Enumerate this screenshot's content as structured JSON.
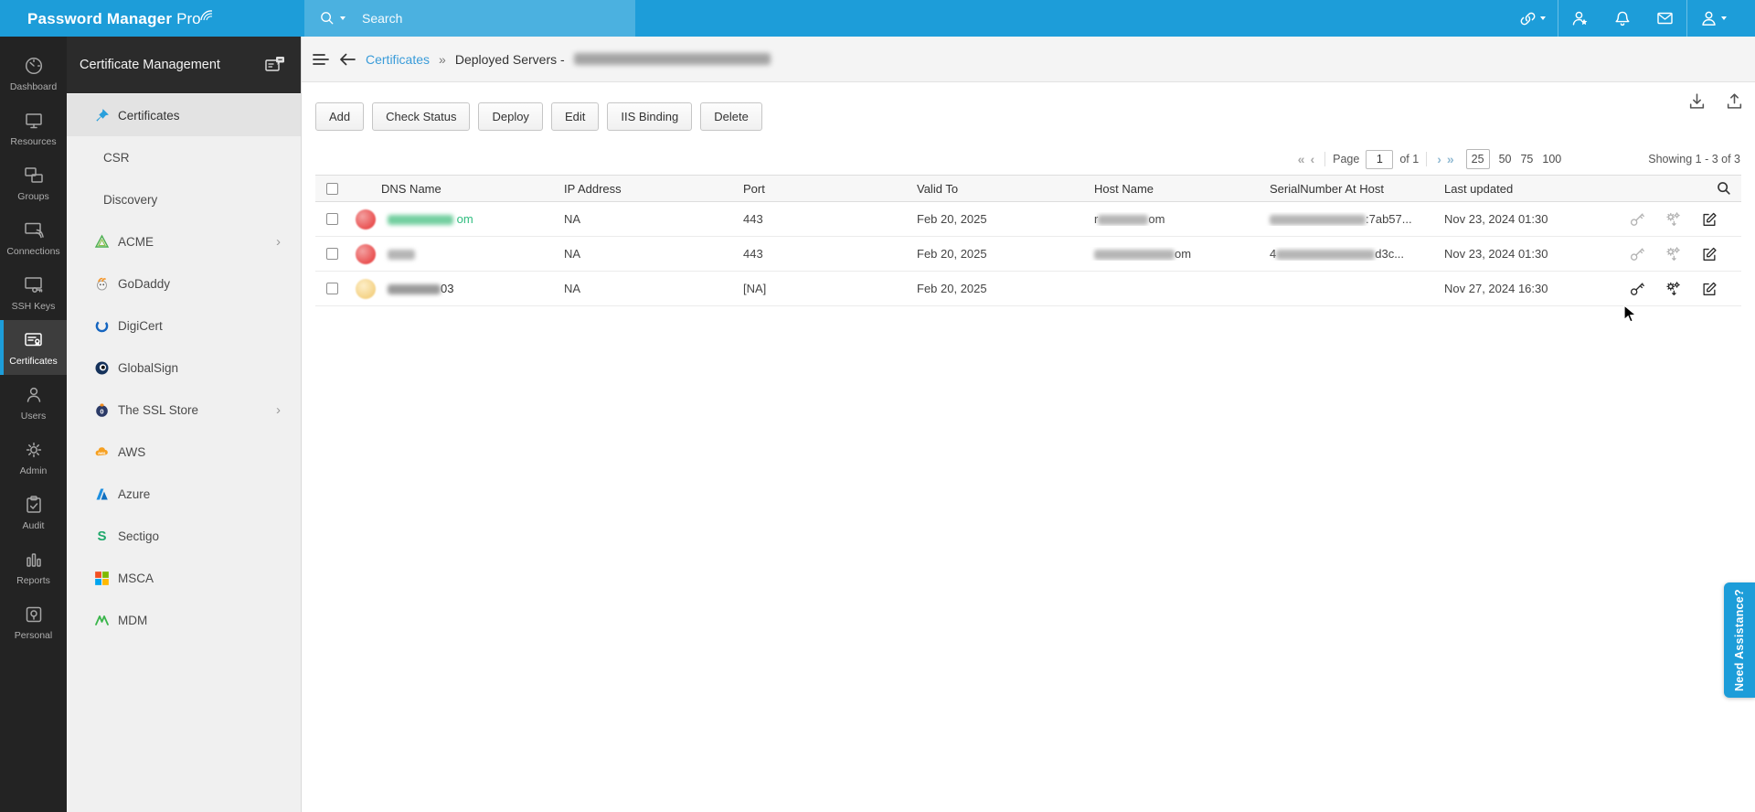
{
  "colors": {
    "accent_blue": "#1d9dd9",
    "search_band": "#4bb1e0",
    "green_link": "#2fbd7f",
    "rail_bg": "#232323",
    "sidebar_bg": "#f0f0f0"
  },
  "topbar": {
    "logo_main": "Password Manager",
    "logo_pro": "Pro",
    "search_placeholder": "Search"
  },
  "rail": {
    "items": [
      {
        "label": "Dashboard",
        "active": false
      },
      {
        "label": "Resources",
        "active": false
      },
      {
        "label": "Groups",
        "active": false
      },
      {
        "label": "Connections",
        "active": false
      },
      {
        "label": "SSH Keys",
        "active": false
      },
      {
        "label": "Certificates",
        "active": true
      },
      {
        "label": "Users",
        "active": false
      },
      {
        "label": "Admin",
        "active": false
      },
      {
        "label": "Audit",
        "active": false
      },
      {
        "label": "Reports",
        "active": false
      },
      {
        "label": "Personal",
        "active": false
      }
    ]
  },
  "sidebar": {
    "title": "Certificate Management",
    "items": [
      {
        "label": "Certificates",
        "active": true
      },
      {
        "label": "CSR"
      },
      {
        "label": "Discovery"
      },
      {
        "label": "ACME",
        "expandable": true
      },
      {
        "label": "GoDaddy"
      },
      {
        "label": "DigiCert"
      },
      {
        "label": "GlobalSign"
      },
      {
        "label": "The SSL Store",
        "expandable": true
      },
      {
        "label": "AWS"
      },
      {
        "label": "Azure"
      },
      {
        "label": "Sectigo"
      },
      {
        "label": "MSCA"
      },
      {
        "label": "MDM"
      }
    ]
  },
  "breadcrumb": {
    "menu_link": "Certificates",
    "separator": "»",
    "current": "Deployed Servers -"
  },
  "toolbar": {
    "buttons": [
      "Add",
      "Check Status",
      "Deploy",
      "Edit",
      "IIS Binding",
      "Delete"
    ]
  },
  "pagination": {
    "first": "«",
    "prev": "‹",
    "page_label": "Page",
    "page_value": "1",
    "of_label": "of 1",
    "next": "›",
    "last": "»",
    "sizes": [
      "25",
      "50",
      "75",
      "100"
    ],
    "active_size": "25",
    "showing": "Showing 1 - 3 of 3"
  },
  "table": {
    "columns": [
      "DNS Name",
      "IP Address",
      "Port",
      "Valid To",
      "Host Name",
      "SerialNumber At Host",
      "Last updated"
    ],
    "rows": [
      {
        "dns_suffix": "om",
        "ip": "NA",
        "port": "443",
        "valid_to": "Feb 20, 2025",
        "host_prefix": "r",
        "host_suffix": "om",
        "serial_prefix": "",
        "serial_suffix": ":7ab57...",
        "last_updated": "Nov 23, 2024 01:30"
      },
      {
        "dns_suffix": "",
        "ip": "NA",
        "port": "443",
        "valid_to": "Feb 20, 2025",
        "host_prefix": "",
        "host_suffix": "om",
        "serial_prefix": "4",
        "serial_suffix": "d3c...",
        "last_updated": "Nov 23, 2024 01:30"
      },
      {
        "dns_suffix": "03",
        "ip": "NA",
        "port": "[NA]",
        "valid_to": "Feb 20, 2025",
        "host_prefix": "",
        "host_suffix": "",
        "serial_prefix": "",
        "serial_suffix": "",
        "last_updated": "Nov 27, 2024 16:30"
      }
    ]
  },
  "assist": {
    "label": "Need Assistance?"
  }
}
